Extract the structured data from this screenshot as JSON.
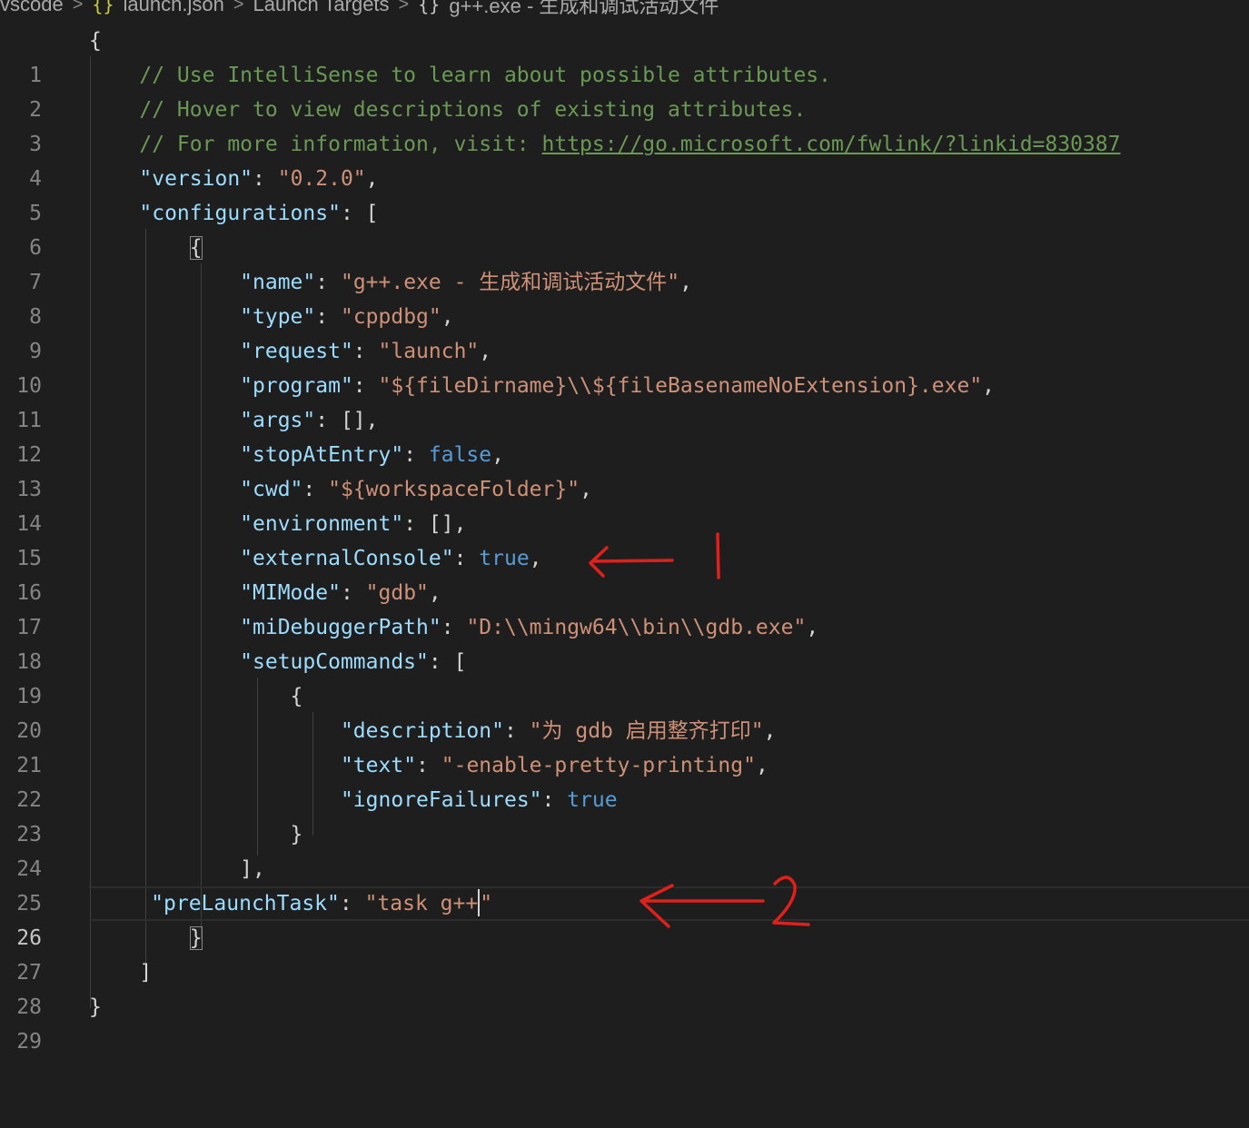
{
  "breadcrumb": {
    "folder": "vscode",
    "json_icon": "{}",
    "file": "launch.json",
    "section": "Launch Targets",
    "obj_icon": "{}",
    "item": "g++.exe - 生成和调试活动文件"
  },
  "lines": [
    {
      "n": "1"
    },
    {
      "n": "2"
    },
    {
      "n": "3"
    },
    {
      "n": "4"
    },
    {
      "n": "5"
    },
    {
      "n": "6"
    },
    {
      "n": "7"
    },
    {
      "n": "8"
    },
    {
      "n": "9"
    },
    {
      "n": "10"
    },
    {
      "n": "11"
    },
    {
      "n": "12"
    },
    {
      "n": "13"
    },
    {
      "n": "14"
    },
    {
      "n": "15"
    },
    {
      "n": "16"
    },
    {
      "n": "17"
    },
    {
      "n": "18"
    },
    {
      "n": "19"
    },
    {
      "n": "20"
    },
    {
      "n": "21"
    },
    {
      "n": "22"
    },
    {
      "n": "23"
    },
    {
      "n": "24"
    },
    {
      "n": "25"
    },
    {
      "n": "26"
    },
    {
      "n": "27"
    },
    {
      "n": "28"
    },
    {
      "n": "29"
    }
  ],
  "code": {
    "open_brace": "{",
    "c1": "// Use IntelliSense to learn about possible attributes.",
    "c2": "// Hover to view descriptions of existing attributes.",
    "c3_text": "// For more information, visit: ",
    "c3_link": "https://go.microsoft.com/fwlink/?linkid=830387",
    "version_key": "\"version\"",
    "version_val": "\"0.2.0\"",
    "configurations_key": "\"configurations\"",
    "name_key": "\"name\"",
    "name_val": "\"g++.exe - 生成和调试活动文件\"",
    "type_key": "\"type\"",
    "type_val": "\"cppdbg\"",
    "request_key": "\"request\"",
    "request_val": "\"launch\"",
    "program_key": "\"program\"",
    "program_val": "\"${fileDirname}\\\\${fileBasenameNoExtension}.exe\"",
    "args_key": "\"args\"",
    "stop_key": "\"stopAtEntry\"",
    "stop_val": "false",
    "cwd_key": "\"cwd\"",
    "cwd_val": "\"${workspaceFolder}\"",
    "env_key": "\"environment\"",
    "ext_key": "\"externalConsole\"",
    "ext_val": "true",
    "mimode_key": "\"MIMode\"",
    "mimode_val": "\"gdb\"",
    "midbg_key": "\"miDebuggerPath\"",
    "midbg_val": "\"D:\\\\mingw64\\\\bin\\\\gdb.exe\"",
    "setup_key": "\"setupCommands\"",
    "desc_key": "\"description\"",
    "desc_val": "\"为 gdb 启用整齐打印\"",
    "text_key": "\"text\"",
    "text_val": "\"-enable-pretty-printing\"",
    "ignore_key": "\"ignoreFailures\"",
    "ignore_val": "true",
    "prelaunch_key": "\"preLaunchTask\"",
    "prelaunch_val_a": "\"task g++",
    "prelaunch_val_b": "\""
  },
  "colors": {
    "background": "#1e1e1e",
    "key": "#9cdcfe",
    "string": "#ce9178",
    "comment": "#6a9955",
    "keyword": "#569cd6",
    "annotation": "#e0201b"
  },
  "icons": [
    "json-icon",
    "object-icon",
    "chevron-right-icon"
  ],
  "annotations": [
    "arrow-1",
    "mark-1",
    "arrow-2",
    "mark-2"
  ]
}
